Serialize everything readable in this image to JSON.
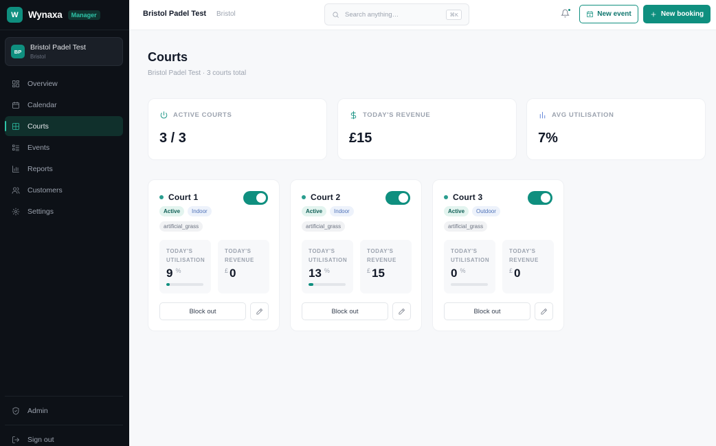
{
  "brand": {
    "logo_letter": "W",
    "name": "Wynaxa",
    "role_badge": "Manager"
  },
  "venue": {
    "initials": "BP",
    "name": "Bristol Padel Test",
    "city": "Bristol"
  },
  "nav": {
    "items": [
      {
        "label": "Overview",
        "icon": "grid-icon",
        "active": false
      },
      {
        "label": "Calendar",
        "icon": "calendar-icon",
        "active": false
      },
      {
        "label": "Courts",
        "icon": "court-grid-icon",
        "active": true
      },
      {
        "label": "Events",
        "icon": "list-icon",
        "active": false
      },
      {
        "label": "Reports",
        "icon": "bar-chart-icon",
        "active": false
      },
      {
        "label": "Customers",
        "icon": "users-icon",
        "active": false
      },
      {
        "label": "Settings",
        "icon": "gear-icon",
        "active": false
      }
    ],
    "admin_label": "Admin",
    "signout_label": "Sign out"
  },
  "topbar": {
    "title": "Bristol Padel Test",
    "subtitle": "Bristol",
    "search_placeholder": "Search anything…",
    "search_shortcut": "⌘K",
    "new_event_label": "New event",
    "new_booking_label": "New booking"
  },
  "page": {
    "title": "Courts",
    "subtitle": "Bristol Padel Test · 3 courts total"
  },
  "stats": [
    {
      "label": "ACTIVE COURTS",
      "value": "3 / 3",
      "icon": "power-icon",
      "color": "#0f8f7f"
    },
    {
      "label": "TODAY'S REVENUE",
      "value": "£15",
      "icon": "dollar-icon",
      "color": "#0f8f7f"
    },
    {
      "label": "AVG UTILISATION",
      "value": "7%",
      "icon": "bar-chart-icon",
      "color": "#5b7fd6"
    }
  ],
  "courts": [
    {
      "name": "Court 1",
      "status": "Active",
      "type": "Indoor",
      "surface": "artificial_grass",
      "utilisation_label": "TODAY'S UTILISATION",
      "utilisation": "9",
      "utilisation_unit": "%",
      "utilisation_pct": 9,
      "revenue_label": "TODAY'S REVENUE",
      "currency": "£",
      "revenue": "0",
      "block_label": "Block out",
      "enabled": true
    },
    {
      "name": "Court 2",
      "status": "Active",
      "type": "Indoor",
      "surface": "artificial_grass",
      "utilisation_label": "TODAY'S UTILISATION",
      "utilisation": "13",
      "utilisation_unit": "%",
      "utilisation_pct": 13,
      "revenue_label": "TODAY'S REVENUE",
      "currency": "£",
      "revenue": "15",
      "block_label": "Block out",
      "enabled": true
    },
    {
      "name": "Court 3",
      "status": "Active",
      "type": "Outdoor",
      "surface": "artificial_grass",
      "utilisation_label": "TODAY'S UTILISATION",
      "utilisation": "0",
      "utilisation_unit": "%",
      "utilisation_pct": 0,
      "revenue_label": "TODAY'S REVENUE",
      "currency": "£",
      "revenue": "0",
      "block_label": "Block out",
      "enabled": true
    }
  ]
}
